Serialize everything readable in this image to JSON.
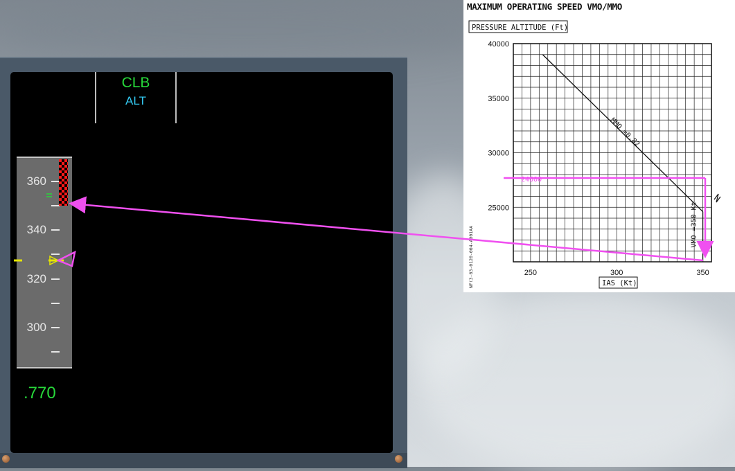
{
  "fma": {
    "mode1": "CLB",
    "mode2": "ALT"
  },
  "speed_tape": {
    "labels": [
      "360",
      "340",
      "320",
      "300"
    ],
    "mach": ".770"
  },
  "vmo_chart": {
    "title": "MAXIMUM OPERATING SPEED VMO/MMO",
    "ylabel": "PRESSURE ALTITUDE (Ft)",
    "xlabel": "IAS (Kt)",
    "y_ticks": [
      "40000",
      "35000",
      "30000",
      "25000"
    ],
    "x_ticks": [
      "250",
      "300",
      "350"
    ],
    "mmo_label": "MMO =0.82",
    "vmo_label": "VMO =350 Kt",
    "marker_label": "24600",
    "doc_ref": "NF(3-03-0120-004-A001AA"
  },
  "colors": {
    "annotation": "#f050f0",
    "fma_green": "#27d83a",
    "fma_cyan": "#33c8f0",
    "speed_trend_yellow": "#e6e600"
  },
  "chart_data": {
    "type": "line",
    "title": "MAXIMUM OPERATING SPEED VMO/MMO",
    "xlabel": "IAS (Kt)",
    "ylabel": "PRESSURE ALTITUDE (Ft)",
    "xlim": [
      240,
      355
    ],
    "ylim": [
      20000,
      40000
    ],
    "x_ticks": [
      250,
      300,
      350
    ],
    "y_ticks": [
      25000,
      30000,
      35000,
      40000
    ],
    "grid": true,
    "series": [
      {
        "name": "MMO =0.82",
        "x": [
          257,
          350
        ],
        "y": [
          39000,
          24600
        ]
      },
      {
        "name": "VMO =350 Kt",
        "x": [
          350,
          350
        ],
        "y": [
          24600,
          20000
        ]
      }
    ],
    "annotations": [
      {
        "text": "24600",
        "x": 240,
        "y": 24600
      }
    ]
  }
}
